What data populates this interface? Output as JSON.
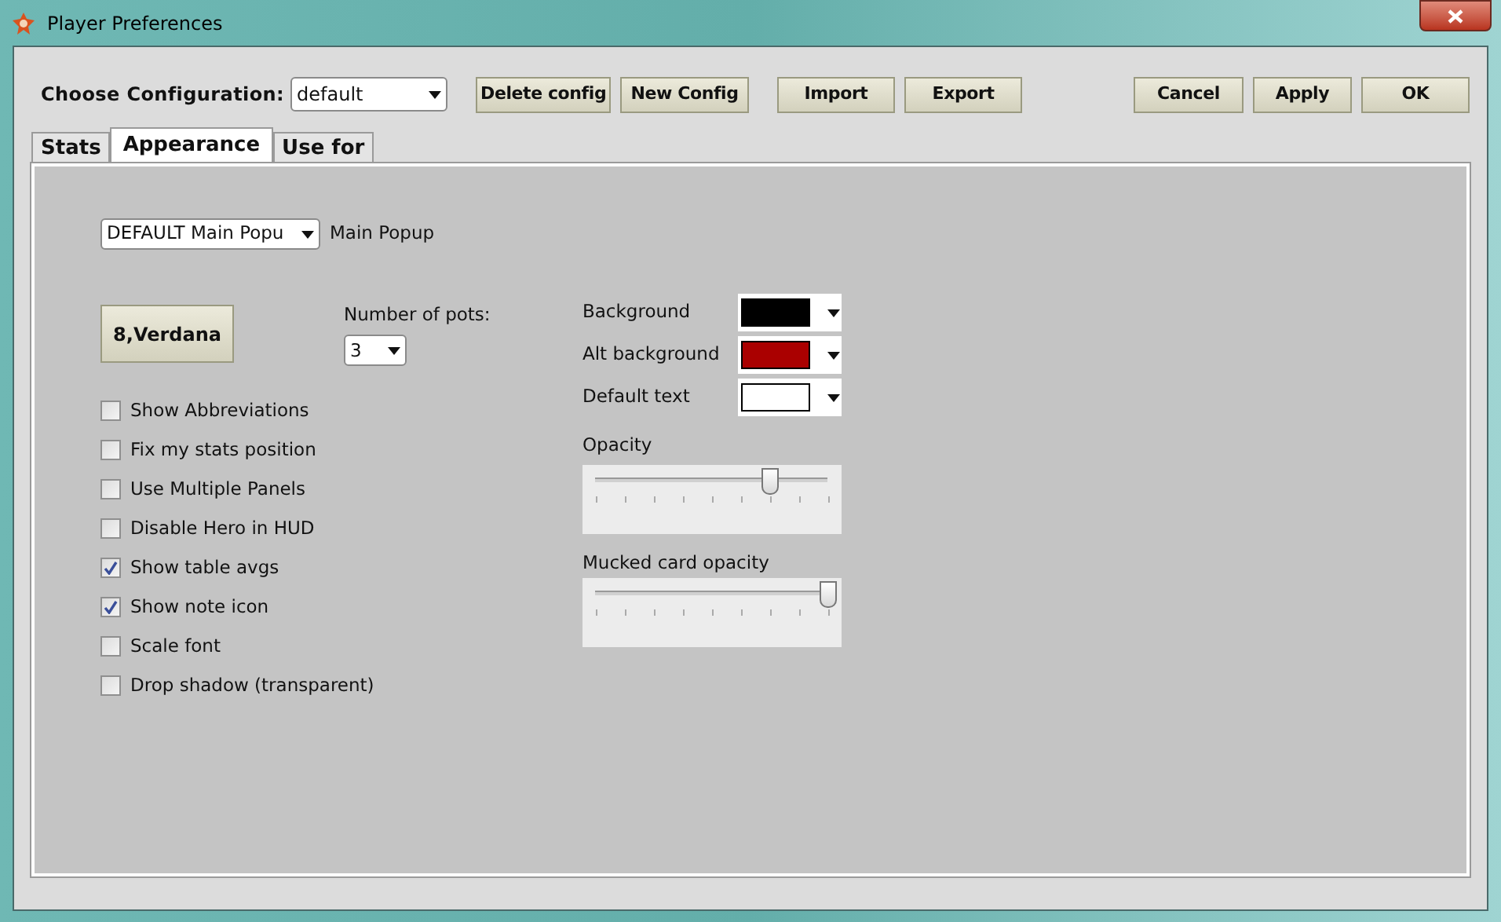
{
  "window": {
    "title": "Player Preferences"
  },
  "configuration": {
    "label": "Choose Configuration:",
    "value": "default"
  },
  "toolbar_buttons": [
    "Delete config",
    "New Config",
    "Import",
    "Export"
  ],
  "dialog_buttons": [
    "Cancel",
    "Apply",
    "OK"
  ],
  "tabs": [
    {
      "label": "Stats",
      "selected": false
    },
    {
      "label": "Appearance",
      "selected": true
    },
    {
      "label": "Use for",
      "selected": false
    }
  ],
  "appearance": {
    "popup_select": {
      "value": "DEFAULT Main Popu"
    },
    "popup_label": "Main Popup",
    "font_button": "8,Verdana",
    "pots": {
      "label": "Number of pots:",
      "value": "3"
    },
    "options": [
      {
        "label": "Show Abbreviations",
        "checked": false
      },
      {
        "label": "Fix my stats position",
        "checked": false
      },
      {
        "label": "Use Multiple Panels",
        "checked": false
      },
      {
        "label": "Disable Hero in HUD",
        "checked": false
      },
      {
        "label": "Show table avgs",
        "checked": true
      },
      {
        "label": "Show note icon",
        "checked": true
      },
      {
        "label": "Scale font",
        "checked": false
      },
      {
        "label": "Drop shadow (transparent)",
        "checked": false
      }
    ],
    "colors": [
      {
        "label": "Background",
        "color": "#000000"
      },
      {
        "label": "Alt background",
        "color": "#aa0000"
      },
      {
        "label": "Default text",
        "color": "#ffffff"
      }
    ],
    "sliders": [
      {
        "label": "Opacity",
        "level": 0.75
      },
      {
        "label": "Mucked card opacity",
        "level": 1
      }
    ]
  }
}
